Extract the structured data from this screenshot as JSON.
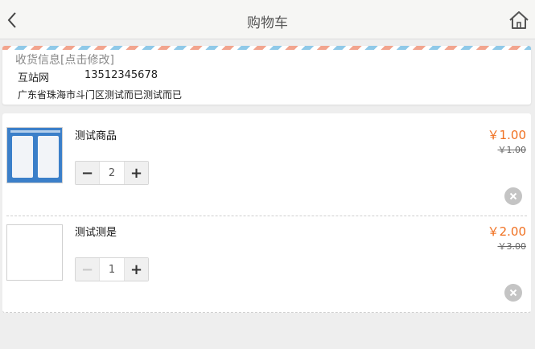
{
  "header": {
    "title": "购物车",
    "back_icon": "chevron-left-icon",
    "home_icon": "home-icon"
  },
  "address": {
    "label": "收货信息[点击修改]",
    "name": "互站网",
    "phone": "13512345678",
    "detail": "广东省珠海市斗门区测试而已测试而已"
  },
  "cart": {
    "items": [
      {
        "name": "测试商品",
        "price": "￥1.00",
        "old_price": "￥1.00",
        "quantity": "2",
        "has_image": true,
        "minus_disabled": false
      },
      {
        "name": "测试测是",
        "price": "￥2.00",
        "old_price": "￥3.00",
        "quantity": "1",
        "has_image": false,
        "minus_disabled": true
      }
    ],
    "minus_label": "−",
    "plus_label": "+"
  },
  "colors": {
    "price": "#f07020",
    "header_bg": "#f6f6f4",
    "page_bg": "#eeeeee"
  }
}
